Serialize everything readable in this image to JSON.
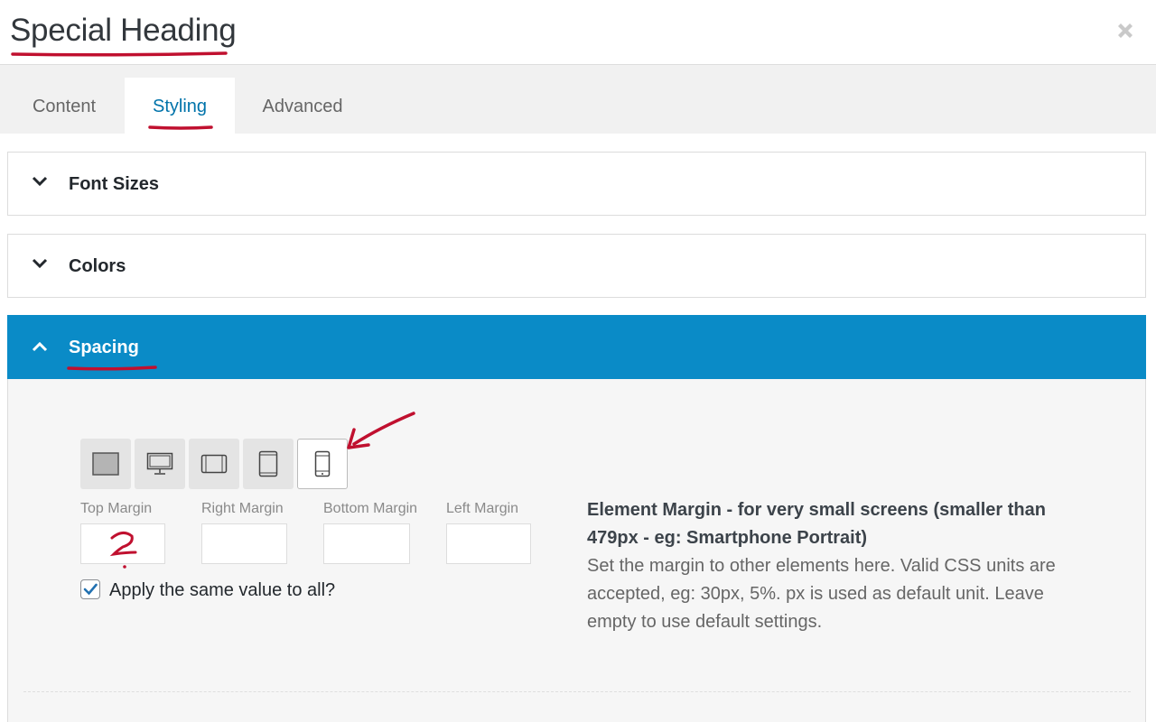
{
  "dialog": {
    "title": "Special Heading"
  },
  "tabs": [
    {
      "label": "Content"
    },
    {
      "label": "Styling"
    },
    {
      "label": "Advanced"
    }
  ],
  "panels": {
    "font_sizes": {
      "label": "Font Sizes"
    },
    "colors": {
      "label": "Colors"
    },
    "spacing": {
      "label": "Spacing"
    }
  },
  "spacing": {
    "devices": [
      "desktop-large-icon",
      "desktop-icon",
      "tablet-landscape-icon",
      "tablet-portrait-icon",
      "smartphone-icon"
    ],
    "active_device": "smartphone-icon",
    "fields": {
      "top": {
        "label": "Top Margin",
        "value": ""
      },
      "right": {
        "label": "Right Margin",
        "value": ""
      },
      "bottom": {
        "label": "Bottom Margin",
        "value": ""
      },
      "left": {
        "label": "Left Margin",
        "value": ""
      }
    },
    "apply_all": {
      "label": "Apply the same value to all?",
      "checked": true
    },
    "description": {
      "title": "Element Margin - for very small screens (smaller than 479px - eg: Smartphone Portrait)",
      "text": "Set the margin to other elements here. Valid CSS units are accepted, eg: 30px, 5%. px is used as default unit. Leave empty to use default settings."
    }
  },
  "colors": {
    "accent": "#0a8bc7",
    "tab_active": "#0073aa",
    "annotation": "#c0102f"
  }
}
